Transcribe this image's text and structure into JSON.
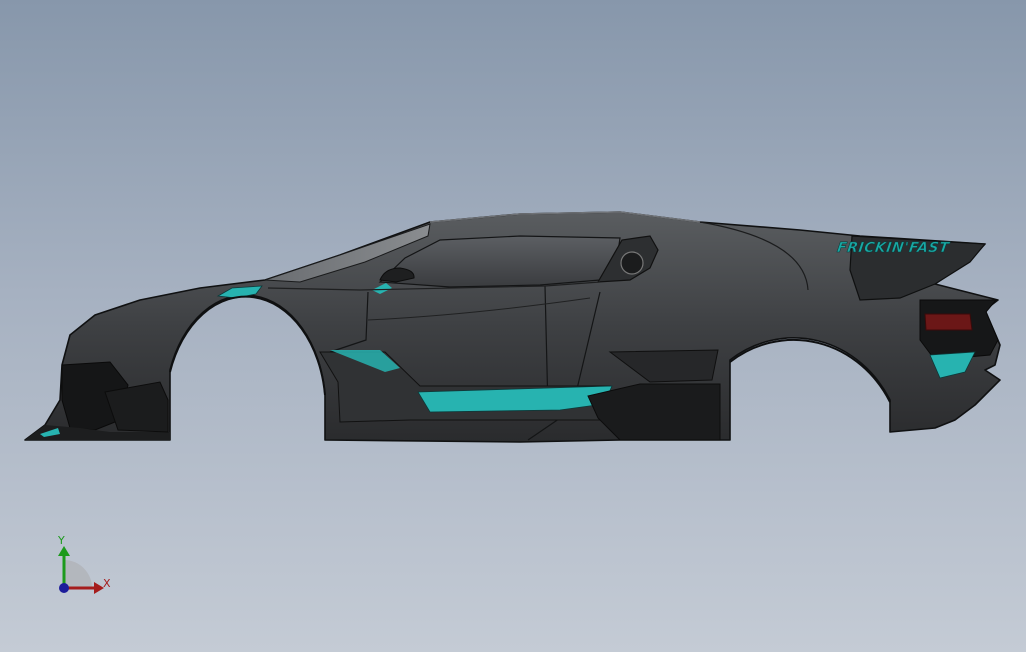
{
  "viewport": {
    "background_top": "#8797ab",
    "background_bottom": "#c4cbd5"
  },
  "model": {
    "body_color": "#3f4144",
    "accent_color": "#27b3b0",
    "decal_text": "FRICKIN'FAST"
  },
  "triad": {
    "x_label": "X",
    "y_label": "Y",
    "x_color": "#a51c1c",
    "y_color": "#1c9a1c",
    "z_color": "#1c1c9a"
  }
}
